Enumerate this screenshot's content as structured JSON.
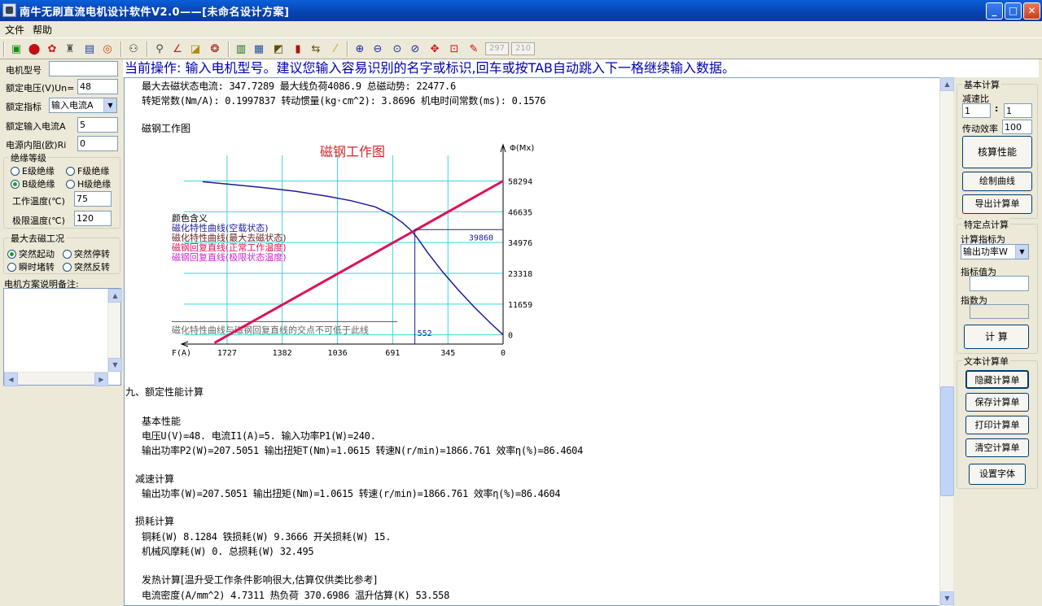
{
  "window": {
    "title": "南牛无刷直流电机设计软件V2.0——[未命名设计方案]",
    "min": "_",
    "max": "□",
    "close": "✕"
  },
  "menu": [
    "文件",
    "帮助"
  ],
  "toolbar": {
    "box1": "297",
    "box2": "210",
    "icons": [
      "new-file-icon",
      "stop-icon",
      "gear-icon",
      "bulb-icon",
      "window-icon",
      "target-icon",
      "magnet-icon",
      "search-icon",
      "line-chart-icon",
      "note-icon",
      "motor-icon",
      "book-icon",
      "doc-icon",
      "layers-icon",
      "barcode-icon",
      "sync-icon",
      "pen-icon",
      "zoom-in-icon",
      "zoom-out-icon",
      "zoom-reset-icon",
      "zoom-fit-icon",
      "move-icon",
      "zoom-window-icon",
      "pencil-icon"
    ]
  },
  "left": {
    "motor_model_label": "电机型号",
    "motor_model_value": "",
    "rated_voltage_label": "额定电压(V)Un=",
    "rated_voltage_value": "48",
    "rated_index_label": "额定指标",
    "rated_index_value": "输入电流A",
    "rated_input_current_label": "额定输入电流A",
    "rated_input_current_value": "5",
    "internal_resistance_label": "电源内阻(欧)Ri",
    "internal_resistance_value": "0",
    "insulation_group": "绝缘等级",
    "insulation": [
      {
        "label": "E级绝缘",
        "checked": false
      },
      {
        "label": "F级绝缘",
        "checked": false
      },
      {
        "label": "B级绝缘",
        "checked": true
      },
      {
        "label": "H级绝缘",
        "checked": false
      }
    ],
    "work_temp_label": "工作温度(℃)",
    "work_temp_value": "75",
    "limit_temp_label": "极限温度(℃)",
    "limit_temp_value": "120",
    "demag_group": "最大去磁工况",
    "demag": [
      {
        "label": "突然起动",
        "checked": true
      },
      {
        "label": "突然停转",
        "checked": false
      },
      {
        "label": "瞬时堵转",
        "checked": false
      },
      {
        "label": "突然反转",
        "checked": false
      }
    ],
    "notes_label": "电机方案说明备注:"
  },
  "status": "当前操作: 输入电机型号。建议您输入容易识别的名字或标识,回车或按TAB自动跳入下一格继续输入数据。",
  "doc": {
    "line1": "最大去磁状态电流: 347.7289    最大线负荷4086.9    总磁动势: 22477.6",
    "line2": "转矩常数(Nm/A): 0.1997837    转动惯量(kg·cm^2): 3.8696    机电时间常数(ms): 0.1576",
    "section_magnet": "磁钢工作图",
    "section9": "九、额定性能计算",
    "basic_title": "基本性能",
    "basic_l1": "电压U(V)=48.    电流I1(A)=5.    输入功率P1(W)=240.",
    "basic_l2": "输出功率P2(W)=207.5051    输出扭矩T(Nm)=1.0615    转速N(r/min)=1866.761    效率η(%)=86.4604",
    "reduce_title": "减速计算",
    "reduce_l1": "输出功率(W)=207.5051    输出扭矩(Nm)=1.0615    转速(r/min)=1866.761    效率η(%)=86.4604",
    "loss_title": "损耗计算",
    "loss_l1": "铜耗(W) 8.1284    铁损耗(W) 9.3666    开关损耗(W) 15.",
    "loss_l2": "机械风摩耗(W) 0.    总损耗(W) 32.495",
    "heat_title": "发热计算[温升受工作条件影响很大,估算仅供类比参考]",
    "heat_l1": "电流密度(A/mm^2) 4.7311    热负荷 370.6986    温升估算(K) 53.558"
  },
  "chart_data": {
    "type": "line",
    "title": "磁钢工作图",
    "xlabel": "F(A)",
    "ylabel": "Φ(Mx)",
    "x_ticks": [
      "1727",
      "1382",
      "1036",
      "691",
      "345",
      "0"
    ],
    "y_ticks": [
      "58294",
      "46635",
      "34976",
      "23318",
      "11659",
      "0"
    ],
    "xlim": [
      2073,
      0
    ],
    "ylim": [
      -3500,
      68000
    ],
    "legend_title": "颜色含义",
    "legend": [
      {
        "label": "磁化特性曲线(空载状态)",
        "color": "#1b1b9c"
      },
      {
        "label": "磁化特性曲线(最大去磁状态)",
        "color": "#6a1f1f"
      },
      {
        "label": "磁钢回复直线(正常工作温度)",
        "color": "#e0105a"
      },
      {
        "label": "磁钢回复直线(极限状态温度)",
        "color": "#cc22cc"
      }
    ],
    "bottom_note": "磁化特性曲线与磁钢回复直线的交点不可低于此线",
    "intersection_flux_label": "39860",
    "intersection_mmf_label": "552",
    "series": [
      {
        "name": "磁化特性曲线(空载状态)",
        "x": [
          1880,
          1700,
          1500,
          1300,
          1100,
          950,
          800,
          700,
          630,
          580,
          540,
          470,
          380,
          280,
          180,
          80,
          0
        ],
        "y": [
          58000,
          57000,
          55800,
          54400,
          52500,
          50800,
          48500,
          45500,
          42500,
          39800,
          37000,
          31000,
          24000,
          17000,
          10500,
          4500,
          0
        ]
      },
      {
        "name": "磁钢回复直线(正常工作温度)",
        "x": [
          1805,
          0
        ],
        "y": [
          -3000,
          58294
        ]
      }
    ],
    "limit_line_y": 5000
  },
  "right": {
    "basic_group": "基本计算",
    "ratio_label": "减速比",
    "ratio_a": "1",
    "ratio_colon": ":",
    "ratio_b": "1",
    "eff_label": "传动效率",
    "eff_value": "100",
    "btn_check": "核算性能",
    "btn_draw": "绘制曲线",
    "btn_export": "导出计算单",
    "spec_group": "特定点计算",
    "calc_index_label": "计算指标为",
    "calc_index_value": "输出功率W",
    "index_value_label": "指标值为",
    "index_value": "",
    "result_label": "指数为",
    "result_value": "",
    "btn_calc": "计  算",
    "text_group": "文本计算单",
    "btn_hide": "隐藏计算单",
    "btn_save": "保存计算单",
    "btn_print": "打印计算单",
    "btn_clear": "清空计算单",
    "btn_font": "设置字体"
  }
}
